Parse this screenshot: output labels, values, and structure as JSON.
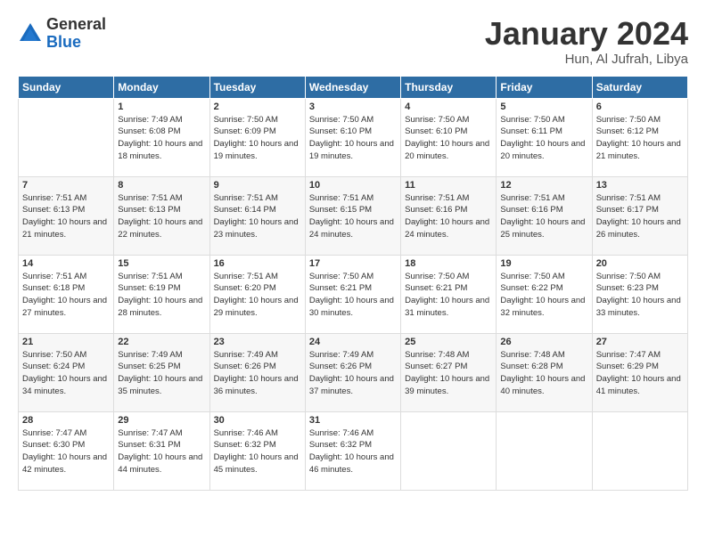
{
  "logo": {
    "general": "General",
    "blue": "Blue"
  },
  "title": "January 2024",
  "location": "Hun, Al Jufrah, Libya",
  "days_header": [
    "Sunday",
    "Monday",
    "Tuesday",
    "Wednesday",
    "Thursday",
    "Friday",
    "Saturday"
  ],
  "weeks": [
    [
      {
        "num": "",
        "sunrise": "",
        "sunset": "",
        "daylight": ""
      },
      {
        "num": "1",
        "sunrise": "Sunrise: 7:49 AM",
        "sunset": "Sunset: 6:08 PM",
        "daylight": "Daylight: 10 hours and 18 minutes."
      },
      {
        "num": "2",
        "sunrise": "Sunrise: 7:50 AM",
        "sunset": "Sunset: 6:09 PM",
        "daylight": "Daylight: 10 hours and 19 minutes."
      },
      {
        "num": "3",
        "sunrise": "Sunrise: 7:50 AM",
        "sunset": "Sunset: 6:10 PM",
        "daylight": "Daylight: 10 hours and 19 minutes."
      },
      {
        "num": "4",
        "sunrise": "Sunrise: 7:50 AM",
        "sunset": "Sunset: 6:10 PM",
        "daylight": "Daylight: 10 hours and 20 minutes."
      },
      {
        "num": "5",
        "sunrise": "Sunrise: 7:50 AM",
        "sunset": "Sunset: 6:11 PM",
        "daylight": "Daylight: 10 hours and 20 minutes."
      },
      {
        "num": "6",
        "sunrise": "Sunrise: 7:50 AM",
        "sunset": "Sunset: 6:12 PM",
        "daylight": "Daylight: 10 hours and 21 minutes."
      }
    ],
    [
      {
        "num": "7",
        "sunrise": "Sunrise: 7:51 AM",
        "sunset": "Sunset: 6:13 PM",
        "daylight": "Daylight: 10 hours and 21 minutes."
      },
      {
        "num": "8",
        "sunrise": "Sunrise: 7:51 AM",
        "sunset": "Sunset: 6:13 PM",
        "daylight": "Daylight: 10 hours and 22 minutes."
      },
      {
        "num": "9",
        "sunrise": "Sunrise: 7:51 AM",
        "sunset": "Sunset: 6:14 PM",
        "daylight": "Daylight: 10 hours and 23 minutes."
      },
      {
        "num": "10",
        "sunrise": "Sunrise: 7:51 AM",
        "sunset": "Sunset: 6:15 PM",
        "daylight": "Daylight: 10 hours and 24 minutes."
      },
      {
        "num": "11",
        "sunrise": "Sunrise: 7:51 AM",
        "sunset": "Sunset: 6:16 PM",
        "daylight": "Daylight: 10 hours and 24 minutes."
      },
      {
        "num": "12",
        "sunrise": "Sunrise: 7:51 AM",
        "sunset": "Sunset: 6:16 PM",
        "daylight": "Daylight: 10 hours and 25 minutes."
      },
      {
        "num": "13",
        "sunrise": "Sunrise: 7:51 AM",
        "sunset": "Sunset: 6:17 PM",
        "daylight": "Daylight: 10 hours and 26 minutes."
      }
    ],
    [
      {
        "num": "14",
        "sunrise": "Sunrise: 7:51 AM",
        "sunset": "Sunset: 6:18 PM",
        "daylight": "Daylight: 10 hours and 27 minutes."
      },
      {
        "num": "15",
        "sunrise": "Sunrise: 7:51 AM",
        "sunset": "Sunset: 6:19 PM",
        "daylight": "Daylight: 10 hours and 28 minutes."
      },
      {
        "num": "16",
        "sunrise": "Sunrise: 7:51 AM",
        "sunset": "Sunset: 6:20 PM",
        "daylight": "Daylight: 10 hours and 29 minutes."
      },
      {
        "num": "17",
        "sunrise": "Sunrise: 7:50 AM",
        "sunset": "Sunset: 6:21 PM",
        "daylight": "Daylight: 10 hours and 30 minutes."
      },
      {
        "num": "18",
        "sunrise": "Sunrise: 7:50 AM",
        "sunset": "Sunset: 6:21 PM",
        "daylight": "Daylight: 10 hours and 31 minutes."
      },
      {
        "num": "19",
        "sunrise": "Sunrise: 7:50 AM",
        "sunset": "Sunset: 6:22 PM",
        "daylight": "Daylight: 10 hours and 32 minutes."
      },
      {
        "num": "20",
        "sunrise": "Sunrise: 7:50 AM",
        "sunset": "Sunset: 6:23 PM",
        "daylight": "Daylight: 10 hours and 33 minutes."
      }
    ],
    [
      {
        "num": "21",
        "sunrise": "Sunrise: 7:50 AM",
        "sunset": "Sunset: 6:24 PM",
        "daylight": "Daylight: 10 hours and 34 minutes."
      },
      {
        "num": "22",
        "sunrise": "Sunrise: 7:49 AM",
        "sunset": "Sunset: 6:25 PM",
        "daylight": "Daylight: 10 hours and 35 minutes."
      },
      {
        "num": "23",
        "sunrise": "Sunrise: 7:49 AM",
        "sunset": "Sunset: 6:26 PM",
        "daylight": "Daylight: 10 hours and 36 minutes."
      },
      {
        "num": "24",
        "sunrise": "Sunrise: 7:49 AM",
        "sunset": "Sunset: 6:26 PM",
        "daylight": "Daylight: 10 hours and 37 minutes."
      },
      {
        "num": "25",
        "sunrise": "Sunrise: 7:48 AM",
        "sunset": "Sunset: 6:27 PM",
        "daylight": "Daylight: 10 hours and 39 minutes."
      },
      {
        "num": "26",
        "sunrise": "Sunrise: 7:48 AM",
        "sunset": "Sunset: 6:28 PM",
        "daylight": "Daylight: 10 hours and 40 minutes."
      },
      {
        "num": "27",
        "sunrise": "Sunrise: 7:47 AM",
        "sunset": "Sunset: 6:29 PM",
        "daylight": "Daylight: 10 hours and 41 minutes."
      }
    ],
    [
      {
        "num": "28",
        "sunrise": "Sunrise: 7:47 AM",
        "sunset": "Sunset: 6:30 PM",
        "daylight": "Daylight: 10 hours and 42 minutes."
      },
      {
        "num": "29",
        "sunrise": "Sunrise: 7:47 AM",
        "sunset": "Sunset: 6:31 PM",
        "daylight": "Daylight: 10 hours and 44 minutes."
      },
      {
        "num": "30",
        "sunrise": "Sunrise: 7:46 AM",
        "sunset": "Sunset: 6:32 PM",
        "daylight": "Daylight: 10 hours and 45 minutes."
      },
      {
        "num": "31",
        "sunrise": "Sunrise: 7:46 AM",
        "sunset": "Sunset: 6:32 PM",
        "daylight": "Daylight: 10 hours and 46 minutes."
      },
      {
        "num": "",
        "sunrise": "",
        "sunset": "",
        "daylight": ""
      },
      {
        "num": "",
        "sunrise": "",
        "sunset": "",
        "daylight": ""
      },
      {
        "num": "",
        "sunrise": "",
        "sunset": "",
        "daylight": ""
      }
    ]
  ]
}
